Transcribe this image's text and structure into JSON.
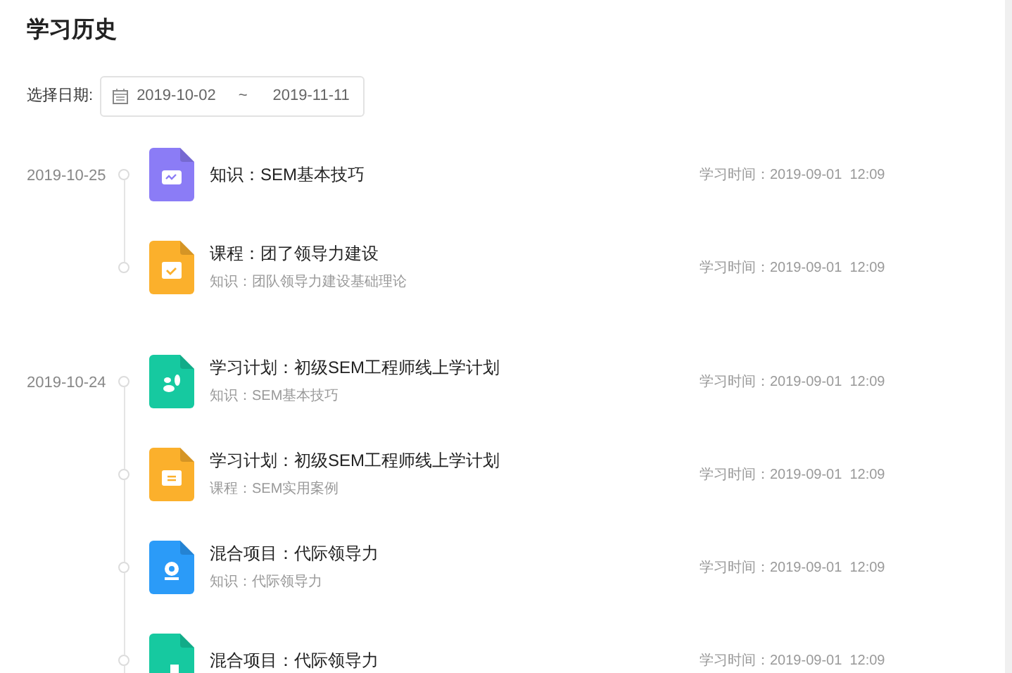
{
  "page": {
    "title": "学习历史"
  },
  "date_filter": {
    "label": "选择日期:",
    "start": "2019-10-02",
    "separator": "~",
    "end": "2019-11-11"
  },
  "groups": [
    {
      "date": "2019-10-25",
      "items": [
        {
          "title": "知识：SEM基本技巧",
          "icon": {
            "kind": "chat",
            "color": "#8b7cf6"
          },
          "time": "学习时间：2019-09-01  12:09"
        },
        {
          "title": "课程：团了领导力建设",
          "subtitle": "知识：团队领导力建设基础理论",
          "icon": {
            "kind": "calendar",
            "color": "#fbb02c"
          },
          "time": "学习时间：2019-09-01  12:09"
        }
      ]
    },
    {
      "date": "2019-10-24",
      "items": [
        {
          "title": "学习计划：初级SEM工程师线上学计划",
          "subtitle": "知识：SEM基本技巧",
          "icon": {
            "kind": "leaf",
            "color": "#16c9a0"
          },
          "time": "学习时间：2019-09-01  12:09"
        },
        {
          "title": "学习计划：初级SEM工程师线上学计划",
          "subtitle": "课程：SEM实用案例",
          "icon": {
            "kind": "folder",
            "color": "#fbb02c"
          },
          "time": "学习时间：2019-09-01  12:09"
        },
        {
          "title": "混合项目：代际领导力",
          "subtitle": "知识：代际领导力",
          "icon": {
            "kind": "camera",
            "color": "#2b9bf8"
          },
          "time": "学习时间：2019-09-01  12:09"
        },
        {
          "title": "混合项目：代际领导力",
          "icon": {
            "kind": "square",
            "color": "#16c9a0"
          },
          "time": "学习时间：2019-09-01  12:09"
        }
      ]
    }
  ]
}
